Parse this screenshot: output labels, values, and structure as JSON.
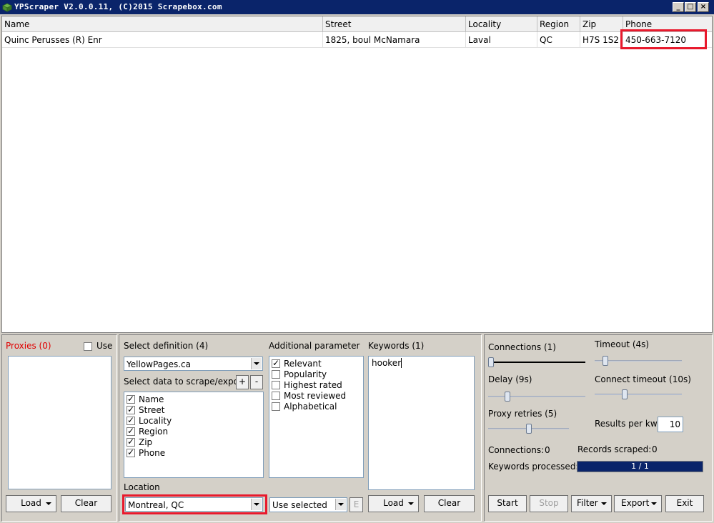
{
  "window": {
    "title": "YPScraper V2.0.0.11, (C)2015 Scrapebox.com",
    "minimize": "_",
    "maximize": "□",
    "close": "×"
  },
  "grid": {
    "columns": [
      "Name",
      "Street",
      "Locality",
      "Region",
      "Zip",
      "Phone"
    ],
    "rows": [
      [
        "Quinc Perusses (R) Enr",
        "1825, boul McNamara",
        "Laval",
        "QC",
        "H7S 1S2",
        "450-663-7120"
      ]
    ]
  },
  "proxies": {
    "label": "Proxies (0)",
    "use_label": "Use",
    "use_checked": false,
    "load_button": "Load",
    "clear_button": "Clear"
  },
  "definition": {
    "label": "Select definition (4)",
    "selected": "YellowPages.ca"
  },
  "scrape_data": {
    "label": "Select data to scrape/export",
    "plus": "+",
    "minus": "-",
    "items": [
      {
        "label": "Name",
        "checked": true
      },
      {
        "label": "Street",
        "checked": true
      },
      {
        "label": "Locality",
        "checked": true
      },
      {
        "label": "Region",
        "checked": true
      },
      {
        "label": "Zip",
        "checked": true
      },
      {
        "label": "Phone",
        "checked": true
      }
    ]
  },
  "additional": {
    "label": "Additional parameter",
    "items": [
      {
        "label": "Relevant",
        "checked": true
      },
      {
        "label": "Popularity",
        "checked": false
      },
      {
        "label": "Highest rated",
        "checked": false
      },
      {
        "label": "Most reviewed",
        "checked": false
      },
      {
        "label": "Alphabetical",
        "checked": false
      }
    ]
  },
  "location": {
    "label": "Location",
    "value": "Montreal, QC",
    "mode": "Use selected",
    "edit_button": "E"
  },
  "keywords": {
    "label": "Keywords (1)",
    "value": "hooker",
    "load_button": "Load",
    "clear_button": "Clear"
  },
  "settings": {
    "connections_label": "Connections (1)",
    "connections_level": 0.0,
    "timeout_label": "Timeout (4s)",
    "timeout_level": 0.1,
    "delay_label": "Delay (9s)",
    "delay_level": 0.18,
    "connect_timeout_label": "Connect timeout (10s)",
    "connect_timeout_level": 0.33,
    "proxy_retries_label": "Proxy retries (5)",
    "proxy_retries_level": 0.5,
    "results_per_kw_label": "Results per kw",
    "results_per_kw": "10"
  },
  "stats": {
    "connections_label": "Connections:",
    "connections_value": "0",
    "records_label": "Records scraped:",
    "records_value": "0",
    "keywords_label": "Keywords processed:",
    "keywords_progress": "1 / 1",
    "keywords_progress_fraction": 1.0
  },
  "actions": {
    "start": "Start",
    "stop": "Stop",
    "filter": "Filter",
    "export": "Export",
    "exit": "Exit"
  },
  "colors": {
    "titlebar": "#0a246a",
    "highlight": "#e8192c",
    "progress": "#0a246a",
    "proxies_label": "#e00000"
  }
}
